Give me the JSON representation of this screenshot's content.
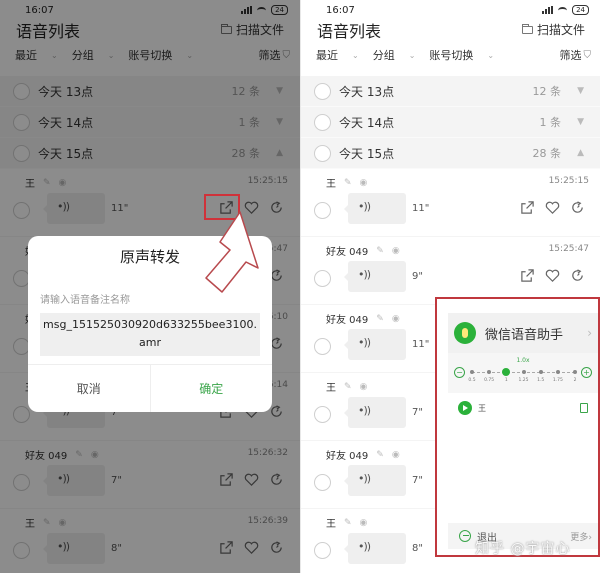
{
  "status_bar": {
    "time": "16:07",
    "battery": "24"
  },
  "header": {
    "title": "语音列表",
    "scan_label": "扫描文件"
  },
  "filters": {
    "recent": "最近",
    "group": "分组",
    "account_switch": "账号切换",
    "filter": "筛选"
  },
  "groups": [
    {
      "label": "今天 13点",
      "count": "12 条",
      "expanded": false
    },
    {
      "label": "今天 14点",
      "count": "1 条",
      "expanded": false
    },
    {
      "label": "今天 15点",
      "count": "28 条",
      "expanded": true
    }
  ],
  "left_messages": [
    {
      "sender": "王",
      "time": "15:25:15",
      "duration": "11\""
    },
    {
      "sender": "好友 049",
      "time": "15:25:47",
      "duration": "9\""
    },
    {
      "sender": "好友 049",
      "time": "15:26:10",
      "duration": "11\""
    },
    {
      "sender": "王",
      "time": "15:26:14",
      "duration": "7\""
    },
    {
      "sender": "好友 049",
      "time": "15:26:32",
      "duration": "7\""
    },
    {
      "sender": "王",
      "time": "15:26:39",
      "duration": "8\""
    }
  ],
  "right_messages": [
    {
      "sender": "王",
      "time": "15:25:15",
      "duration": "11\""
    },
    {
      "sender": "好友 049",
      "time": "15:25:47",
      "duration": "9\""
    },
    {
      "sender": "好友 049",
      "time": "",
      "duration": "11\""
    },
    {
      "sender": "王",
      "time": "",
      "duration": "7\""
    },
    {
      "sender": "好友 049",
      "time": "",
      "duration": "7\""
    },
    {
      "sender": "王",
      "time": "",
      "duration": "8\""
    }
  ],
  "dialog": {
    "title": "原声转发",
    "hint": "请输入语音备注名称",
    "value": "msg_151525030920d633255bee3100.amr",
    "cancel": "取消",
    "confirm": "确定"
  },
  "assistant": {
    "title": "微信语音助手",
    "speed_current": "1.0x",
    "speed_value": 1.0,
    "speed_options": [
      "0.5",
      "0.75",
      "1",
      "1.25",
      "1.5",
      "1.75",
      "2"
    ],
    "playing_name": "王",
    "exit_label": "退出",
    "more_label": "更多"
  },
  "watermark": "知乎 @宇宙心",
  "colors": {
    "accent_green": "#2bb13a",
    "highlight_red": "#d0323a"
  }
}
